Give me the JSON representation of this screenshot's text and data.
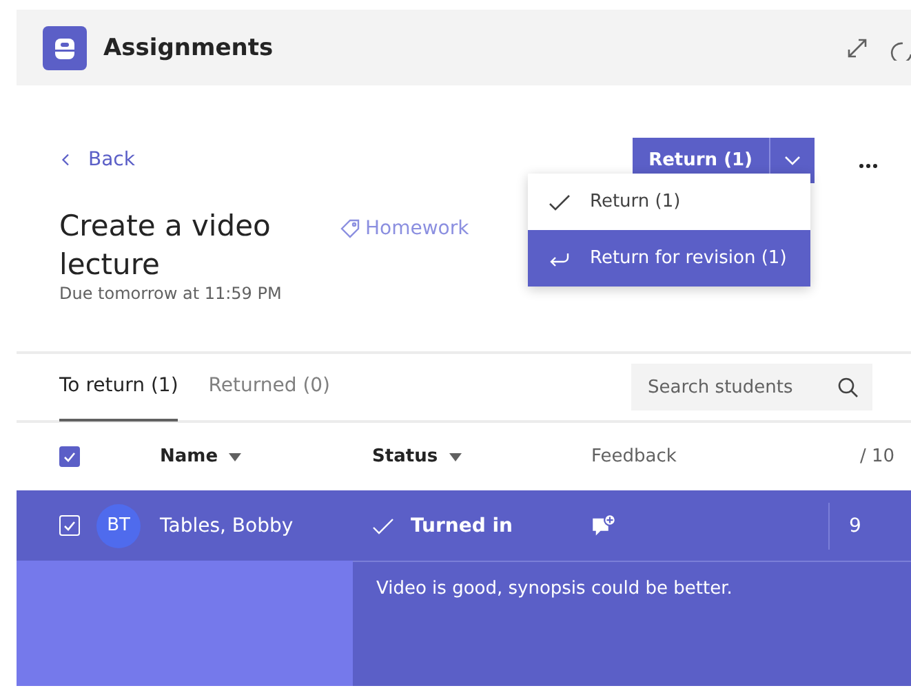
{
  "app": {
    "title": "Assignments"
  },
  "back": "Back",
  "return_button": {
    "label": "Return (1)"
  },
  "menu": [
    {
      "label": "Return (1)",
      "kind": "check",
      "selected": false
    },
    {
      "label": "Return for revision (1)",
      "kind": "revise",
      "selected": true
    }
  ],
  "assignment": {
    "title": "Create a video lecture",
    "tag": "Homework",
    "due": "Due tomorrow at 11:59 PM"
  },
  "tabs": [
    {
      "label": "To return (1)",
      "selected": true
    },
    {
      "label": "Returned (0)",
      "selected": false
    }
  ],
  "search": {
    "placeholder": "Search students"
  },
  "columns": {
    "name": "Name",
    "status": "Status",
    "feedback": "Feedback",
    "points": "/ 10"
  },
  "select_all": {
    "checked": true
  },
  "rows": [
    {
      "initials": "BT",
      "name": "Tables, Bobby",
      "status": "Turned in",
      "points": "9",
      "checked": true,
      "selected": true,
      "feedback": "Video is good, synopsis could be better."
    }
  ]
}
